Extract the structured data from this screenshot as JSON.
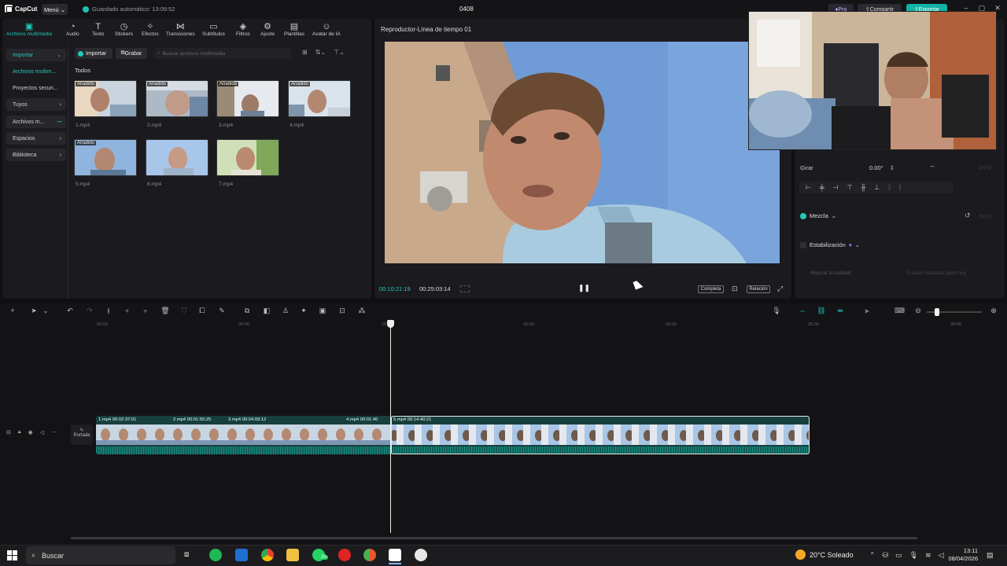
{
  "app": {
    "logo_text": "CapCut",
    "menu_label": "Menú",
    "autosave": "Guardado automático: 13:09:52",
    "project_title": "0408",
    "pro_label": "Pro",
    "share_label": "Compartir",
    "export_label": "Exportar",
    "accent": "#22c8bb"
  },
  "media_tabs": [
    {
      "label": "Archivos multimedia",
      "icon": "media-icon"
    },
    {
      "label": "Audio",
      "icon": "audio-icon"
    },
    {
      "label": "Texto",
      "icon": "text-icon"
    },
    {
      "label": "Stickers",
      "icon": "sticker-icon"
    },
    {
      "label": "Efectos",
      "icon": "effects-icon"
    },
    {
      "label": "Transiciones",
      "icon": "transition-icon"
    },
    {
      "label": "Subtítulos",
      "icon": "subtitle-icon"
    },
    {
      "label": "Filtros",
      "icon": "filter-icon"
    },
    {
      "label": "Ajuste",
      "icon": "adjust-icon"
    },
    {
      "label": "Plantillas",
      "icon": "template-icon"
    },
    {
      "label": "Avatar de IA",
      "icon": "avatar-icon"
    }
  ],
  "media_sidebar": [
    {
      "label": "Importar"
    },
    {
      "label": "Archivos multim..."
    },
    {
      "label": "Proyectos secun..."
    },
    {
      "label": "Tuyos"
    },
    {
      "label": "Archivos m..."
    },
    {
      "label": "Espacios"
    },
    {
      "label": "Biblioteca"
    }
  ],
  "media_toolbar": {
    "import_label": "Importar",
    "record_label": "Grabar",
    "search_placeholder": "Buscar archivos multimedia",
    "filter_label": "Todos"
  },
  "media_items": [
    {
      "name": "1.mp4",
      "badge": "Añadido"
    },
    {
      "name": "2.mp4",
      "badge": "Añadido"
    },
    {
      "name": "3.mp4",
      "badge": "Añadido"
    },
    {
      "name": "4.mp4",
      "badge": "Añadido"
    },
    {
      "name": "5.mp4",
      "badge": "Añadido"
    },
    {
      "name": "6.mp4",
      "badge": ""
    },
    {
      "name": "7.mp4",
      "badge": ""
    }
  ],
  "player": {
    "title": "Reproductor-Línea de tiempo 01",
    "current_time": "00:10:21:19",
    "total_time": "00:25:03:14",
    "complete_label": "Completa",
    "ratio_label": "Relación"
  },
  "properties": {
    "rotate_label": "Girar",
    "rotate_value": "0.00°",
    "blend_label": "Mezcla",
    "stabilize_label": "Estabilización",
    "quality_label": "Mejorar la calidad",
    "quality_note": "5 usos restantes para hoy"
  },
  "timeline": {
    "ticks": [
      "00:00",
      "05:00",
      "10:00",
      "15:00",
      "20:00",
      "25:00",
      "30:00"
    ],
    "cover_label": "Portada",
    "clips": [
      {
        "label": "1.mp4  00:02:37:01"
      },
      {
        "label": "2.mp4  00:01:55:25"
      },
      {
        "label": "3.mp4  00:04:09:12"
      },
      {
        "label": "4.mp4  00:01:40"
      },
      {
        "label": "5.mp4  00:14:40:21"
      }
    ]
  },
  "taskbar": {
    "search_label": "Buscar",
    "weather": "20°C Soleado",
    "time": "13:11",
    "date": "08/04/2026",
    "whatsapp_badge": "20"
  }
}
